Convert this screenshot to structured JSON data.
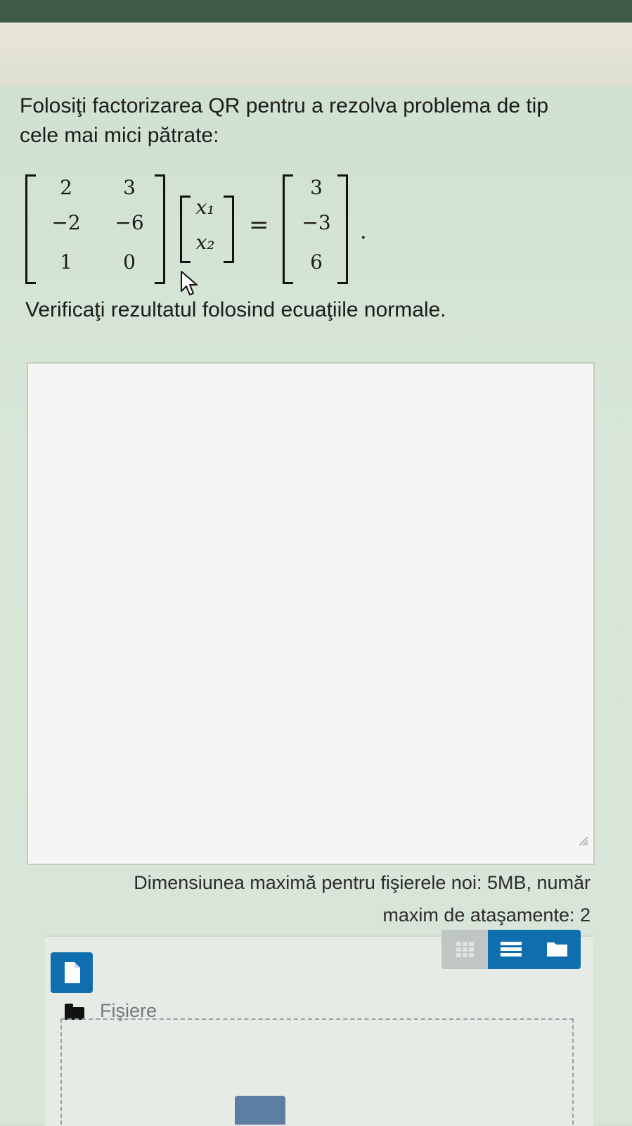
{
  "question": {
    "line1": "Folosiţi factorizarea QR pentru a rezolva problema de tip",
    "line2": "cele mai mici pătrate:",
    "matrix_A": [
      [
        "2",
        "3"
      ],
      [
        "−2",
        "−6"
      ],
      [
        "1",
        "0"
      ]
    ],
    "vector_x": [
      "x₁",
      "x₂"
    ],
    "vector_b": [
      "3",
      "−3",
      "6"
    ],
    "equals": "=",
    "period": ".",
    "verify": "Verificaţi rezultatul folosind ecuaţiile normale."
  },
  "answer": {
    "value": ""
  },
  "attachments": {
    "limits_line1": "Dimensiunea maximă pentru fişierele noi: 5MB, număr",
    "limits_line2": "maxim de ataşamente: 2",
    "files_label": "Fişiere"
  },
  "icons": {
    "add_file": "file-icon",
    "grid_view": "grid-icon",
    "list_view": "list-icon",
    "tree_view": "folder-icon",
    "folder": "folder-icon",
    "upload": "upload-icon",
    "cursor": "mouse-pointer-icon"
  },
  "colors": {
    "primary_button": "#0f6fae",
    "disabled_button": "#bfc6c4",
    "page_background": "#d7e6d8"
  }
}
